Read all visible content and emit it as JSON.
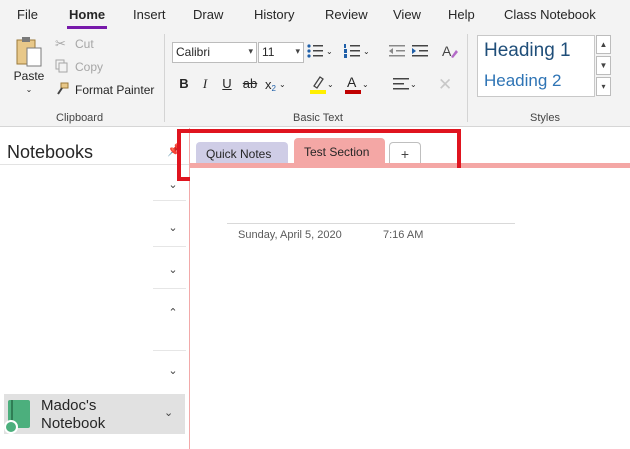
{
  "menu": {
    "items": [
      "File",
      "Home",
      "Insert",
      "Draw",
      "History",
      "Review",
      "View",
      "Help",
      "Class Notebook"
    ],
    "active": "Home"
  },
  "ribbon": {
    "clipboard": {
      "paste": "Paste",
      "cut": "Cut",
      "copy": "Copy",
      "format_painter": "Format Painter",
      "label": "Clipboard"
    },
    "basic_text": {
      "font": "Calibri",
      "size": "11",
      "bold": "B",
      "italic": "I",
      "underline": "U",
      "strike": "ab",
      "subscript": "x",
      "label": "Basic Text"
    },
    "styles": {
      "heading1": "Heading 1",
      "heading2": "Heading 2",
      "label": "Styles"
    }
  },
  "notebooks": {
    "title": "Notebooks",
    "current": {
      "name_line1": "Madoc's",
      "name_line2": "Notebook"
    }
  },
  "sections": {
    "tabs": [
      "Quick Notes",
      "Test Section"
    ],
    "add": "+",
    "active": "Test Section"
  },
  "page": {
    "date": "Sunday, April 5, 2020",
    "time": "7:16 AM"
  },
  "colors": {
    "accent": "#7719aa",
    "section_active": "#f4a7a5",
    "section_quick": "#cfcde6",
    "highlight_box": "#e0141f",
    "notebook_icon": "#4caf7d"
  }
}
